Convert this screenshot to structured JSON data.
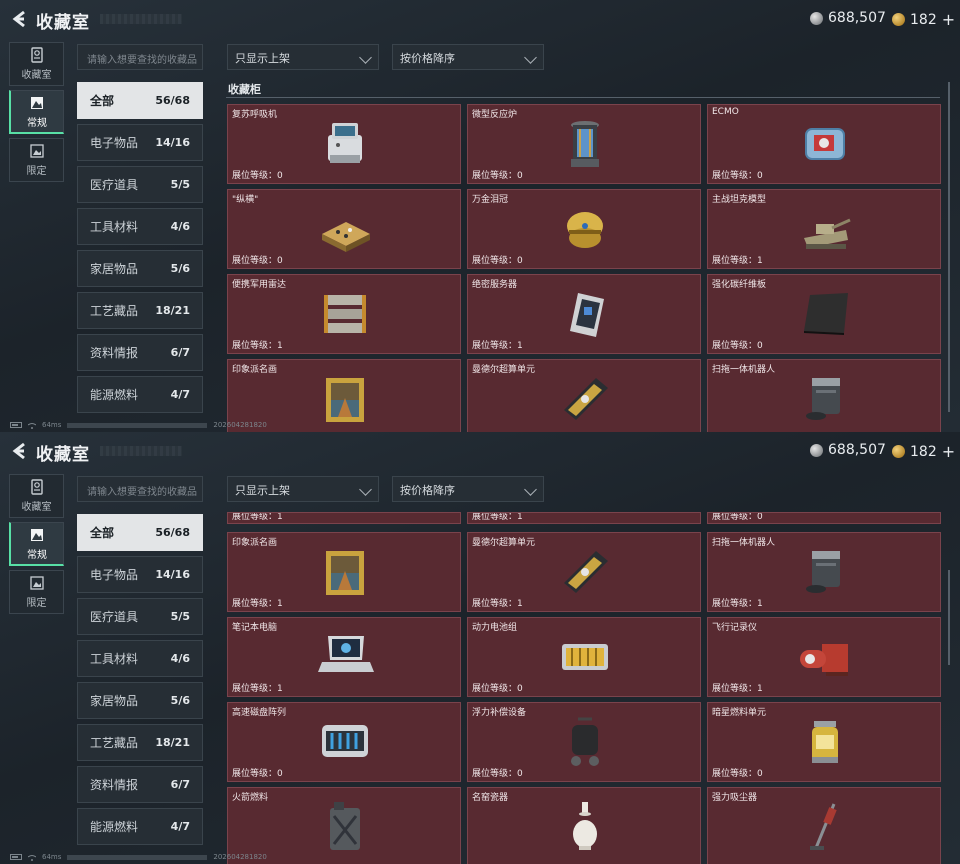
{
  "header": {
    "title": "收藏室",
    "silver": "688,507",
    "gold": "182",
    "plus": "+"
  },
  "left_tabs": [
    {
      "label": "收藏室",
      "icon": "trophy-icon"
    },
    {
      "label": "常规",
      "icon": "picture-icon"
    },
    {
      "label": "限定",
      "icon": "picture-alt-icon"
    }
  ],
  "search": {
    "placeholder": "请输入想要查找的收藏品"
  },
  "filter": {
    "label": "只显示上架"
  },
  "sort": {
    "label": "按价格降序"
  },
  "categories": [
    {
      "label": "全部",
      "count": "56/68"
    },
    {
      "label": "电子物品",
      "count": "14/16"
    },
    {
      "label": "医疗道具",
      "count": "5/5"
    },
    {
      "label": "工具材料",
      "count": "4/6"
    },
    {
      "label": "家居物品",
      "count": "5/6"
    },
    {
      "label": "工艺藏品",
      "count": "18/21"
    },
    {
      "label": "资料情报",
      "count": "6/7"
    },
    {
      "label": "能源燃料",
      "count": "4/7"
    }
  ],
  "section_title": "收藏柜",
  "level_prefix": "展位等级：",
  "status": {
    "ping": "64ms",
    "id": "202604281820"
  },
  "panel1_items": [
    {
      "name": "复苏呼吸机",
      "level": "0",
      "icon": "ventilator-icon"
    },
    {
      "name": "微型反应炉",
      "level": "0",
      "icon": "reactor-icon"
    },
    {
      "name": "ECMO",
      "level": "0",
      "icon": "ecmo-icon"
    },
    {
      "name": "\"纵横\"",
      "level": "0",
      "icon": "chessboard-icon"
    },
    {
      "name": "万金泪冠",
      "level": "0",
      "icon": "crown-egg-icon"
    },
    {
      "name": "主战坦克模型",
      "level": "1",
      "icon": "tank-model-icon"
    },
    {
      "name": "便携军用雷达",
      "level": "1",
      "icon": "radar-icon"
    },
    {
      "name": "绝密服务器",
      "level": "1",
      "icon": "server-icon"
    },
    {
      "name": "强化碳纤维板",
      "level": "0",
      "icon": "carbon-plate-icon"
    },
    {
      "name": "印象派名画",
      "level": "",
      "icon": "painting-icon"
    },
    {
      "name": "曼德尔超算单元",
      "level": "",
      "icon": "gpu-icon"
    },
    {
      "name": "扫拖一体机器人",
      "level": "",
      "icon": "robot-vacuum-icon"
    }
  ],
  "panel2_top": [
    "1",
    "1",
    "0"
  ],
  "panel2_items": [
    {
      "name": "印象派名画",
      "level": "1",
      "icon": "painting-icon"
    },
    {
      "name": "曼德尔超算单元",
      "level": "1",
      "icon": "gpu-icon"
    },
    {
      "name": "扫拖一体机器人",
      "level": "1",
      "icon": "robot-vacuum-icon"
    },
    {
      "name": "笔记本电脑",
      "level": "1",
      "icon": "laptop-icon"
    },
    {
      "name": "动力电池组",
      "level": "0",
      "icon": "battery-pack-icon"
    },
    {
      "name": "飞行记录仪",
      "level": "1",
      "icon": "flight-recorder-icon"
    },
    {
      "name": "高速磁盘阵列",
      "level": "0",
      "icon": "disk-array-icon"
    },
    {
      "name": "浮力补偿设备",
      "level": "0",
      "icon": "buoyancy-device-icon"
    },
    {
      "name": "暗星燃料单元",
      "level": "0",
      "icon": "fuel-cell-icon"
    },
    {
      "name": "火箭燃料",
      "level": "",
      "icon": "jerrycan-icon"
    },
    {
      "name": "名窑瓷器",
      "level": "",
      "icon": "porcelain-vase-icon"
    },
    {
      "name": "强力吸尘器",
      "level": "",
      "icon": "vacuum-cleaner-icon"
    }
  ]
}
